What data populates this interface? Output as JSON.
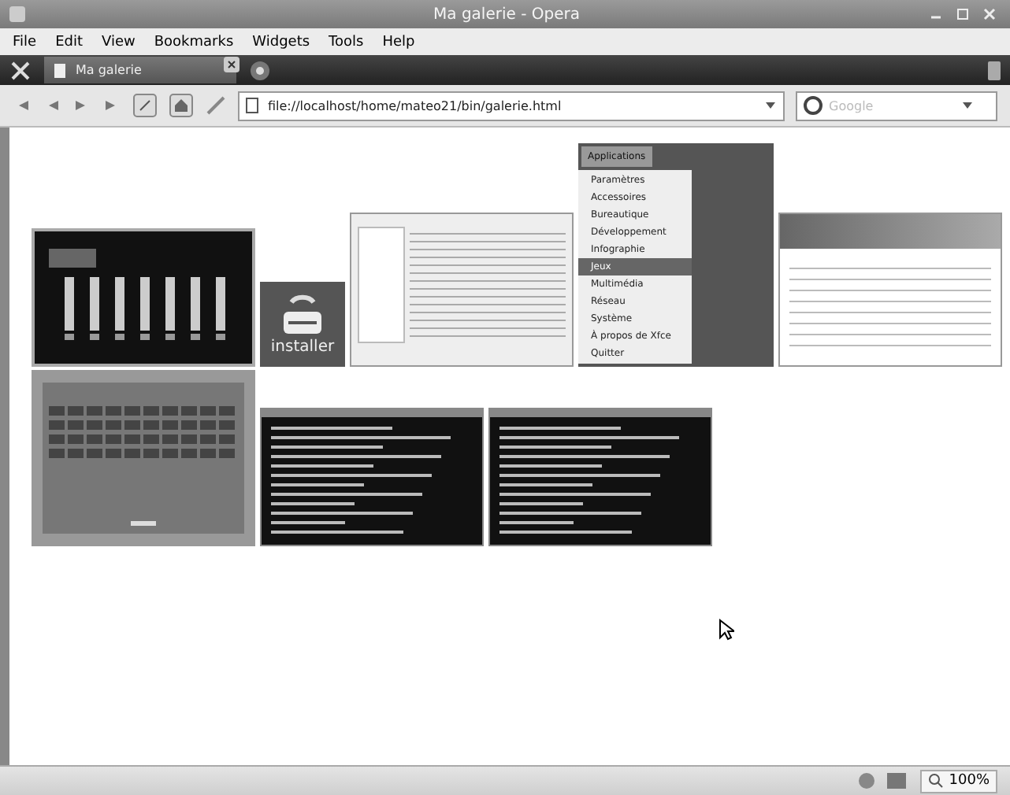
{
  "window": {
    "title": "Ma galerie - Opera"
  },
  "menu": [
    "File",
    "Edit",
    "View",
    "Bookmarks",
    "Widgets",
    "Tools",
    "Help"
  ],
  "tabs": [
    {
      "label": "Ma galerie",
      "selected": true
    }
  ],
  "address": {
    "value": "file://localhost/home/mateo21/bin/galerie.html"
  },
  "search": {
    "placeholder": "Google"
  },
  "gallery_rows": [
    [
      {
        "kind": "terminal"
      },
      {
        "kind": "installer",
        "label": "installer"
      },
      {
        "kind": "dialog"
      },
      {
        "kind": "appmenu",
        "button": "Applications",
        "items": [
          {
            "label": "Paramètres",
            "selected": false
          },
          {
            "label": "Accessoires",
            "selected": false
          },
          {
            "label": "Bureautique",
            "selected": false
          },
          {
            "label": "Développement",
            "selected": false
          },
          {
            "label": "Infographie",
            "selected": false
          },
          {
            "label": "Jeux",
            "selected": true
          },
          {
            "label": "Multimédia",
            "selected": false
          },
          {
            "label": "Réseau",
            "selected": false
          },
          {
            "label": "Système",
            "selected": false
          },
          {
            "label": "À propos de Xfce",
            "selected": false
          },
          {
            "label": "Quitter",
            "selected": false
          }
        ]
      },
      {
        "kind": "webpage"
      }
    ],
    [
      {
        "kind": "game"
      },
      {
        "kind": "terminal_text"
      },
      {
        "kind": "terminal_text"
      }
    ]
  ],
  "status_bar": {
    "zoom": "100%"
  }
}
